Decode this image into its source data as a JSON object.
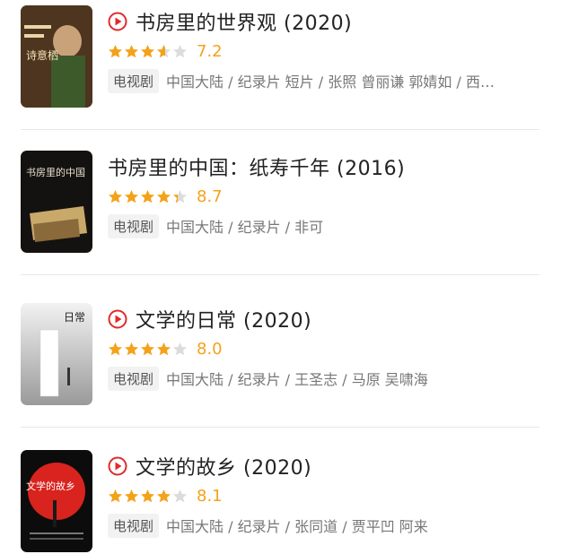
{
  "items": [
    {
      "title": "书房里的世界观 (2020)",
      "has_play_icon": true,
      "rating": 7.2,
      "score": "7.2",
      "badge": "电视剧",
      "meta": "中国大陆 / 纪录片 短片 / 张照 曾丽谦 郭婧如 / 西…",
      "poster_text": "诗意栖"
    },
    {
      "title": "书房里的中国：纸寿千年 (2016)",
      "has_play_icon": false,
      "rating": 8.7,
      "score": "8.7",
      "badge": "电视剧",
      "meta": "中国大陆 / 纪录片 / 非可",
      "poster_text": "书房里的中国"
    },
    {
      "title": "文学的日常 (2020)",
      "has_play_icon": true,
      "rating": 8.0,
      "score": "8.0",
      "badge": "电视剧",
      "meta": "中国大陆 / 纪录片 / 王圣志 / 马原 吴啸海",
      "poster_text": "日常"
    },
    {
      "title": "文学的故乡 (2020)",
      "has_play_icon": true,
      "rating": 8.1,
      "score": "8.1",
      "badge": "电视剧",
      "meta": "中国大陆 / 纪录片 / 张同道 / 贾平凹 阿来",
      "poster_text": "文学的故乡"
    }
  ],
  "colors": {
    "star_on": "#f4a21a",
    "star_off": "#dcdcdc",
    "play": "#e02b2b",
    "score": "#f4a21a"
  }
}
